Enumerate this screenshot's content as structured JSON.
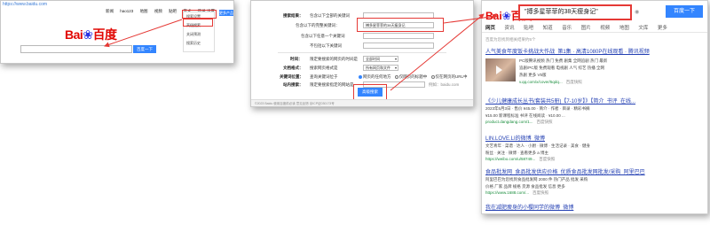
{
  "panel1": {
    "url": "https://www.baidu.com",
    "nav": [
      "新闻",
      "hao123",
      "地图",
      "视频",
      "贴吧",
      "学术",
      "登录"
    ],
    "settings_label": "设置",
    "more_label": "更多产品",
    "settings_menu": [
      "搜索设置",
      "高级搜索",
      "关闭预测",
      "搜索历史"
    ],
    "logo_bai": "Bai",
    "logo_du": "百度",
    "search_placeholder": "",
    "search_button": "百度一下"
  },
  "panel2": {
    "section_search_results": "搜索结果：",
    "fields": [
      {
        "label": "包含以下全部的关键词",
        "value": ""
      },
      {
        "label": "包含以下的完整关键词：",
        "value": "搏多星菲菲的38天瘦身记"
      },
      {
        "label": "包含以下任意一个关键词",
        "value": ""
      },
      {
        "label": "不包括以下关键词",
        "value": ""
      }
    ],
    "time_label": "时间：",
    "time_desc": "限定要搜索的网页的时间是",
    "time_value": "全部时间",
    "doctype_label": "文档格式：",
    "doctype_desc": "搜索网页格式是",
    "doctype_value": "所有网页和文件",
    "position_label": "关键词位置：",
    "position_desc": "查询关键词位于",
    "position_options": [
      "网页的任何地方",
      "仅网页的标题中",
      "仅在网页的URL中"
    ],
    "site_label": "站内搜索：",
    "site_desc": "限定要搜索指定的网站是",
    "site_example": "例如：baidu.com",
    "submit": "高级搜索",
    "footer": "©2023 Baidu 使用百度前必读 意见反馈 京ICP证030173号"
  },
  "panel3": {
    "logo_bai": "Bai",
    "logo_du": "百度",
    "query": "\"搏多星菲菲的38天瘦身记\"",
    "search_button": "百度一下",
    "tabs": [
      "网页",
      "资讯",
      "贴吧",
      "知道",
      "音乐",
      "图片",
      "视频",
      "地图",
      "文库",
      "更多"
    ],
    "result_count": "百度为您找到相关结果约5个",
    "results": [
      {
        "title": "人气美食年度饭卡挑战大作战_第1集 · 高清1080P在线观看 · 腾讯视频",
        "desc": [
          "PC版腾讯视频 热门 免费 剧集 全网追剧 热门 最新",
          "追剧/PC版 免费观看 电视剧 人气 综艺 热播 全网",
          "热剧 更多 V5版"
        ],
        "url": "v.qq.com/x/cover/5qdq...",
        "snap": "百度快照"
      },
      {
        "title": "《少儿健康成长丛书(套装共5册)【7-10岁】》【简介_书评_在线...",
        "desc": [
          "2023年5月3日 · 售价 ¥45.00 · 简介 · 作者 · 目录 · 精彩书摘",
          "¥15.00 新课程标准 书评 在线阅读 · ¥10.00 ..."
        ],
        "url": "product.dangdang.com/1...",
        "snap": "百度快照"
      },
      {
        "title": "LIN.LOVE.LI的微博_微博",
        "desc": [
          "文艺青年 · 菜谱 · 达人 · 小厨 · 微博 · 生活记录 · 美食 · 健身",
          "粉丝 · 关注 · 微博 · 查看更多 a 博主"
        ],
        "url": "https://weibo.com/u/58749...",
        "snap": "百度快照"
      },
      {
        "title": "食品批发网_食品批发供应价格_优质食品批发网批发/采购_阿里巴巴",
        "desc": [
          "阿里巴巴为您找到食品批发网 2000 件 热门产品 批发 采购",
          "价格 厂家 品牌 规格 货源 食品批发 信息 更多"
        ],
        "url": "https://www.1688.com/...",
        "snap": "百度快照"
      },
      {
        "title": "我在减肥瘦身的小樱同学的微博_微博",
        "desc": [],
        "url": "",
        "snap": ""
      }
    ]
  },
  "colors": {
    "baidu_blue": "#3385ff",
    "baidu_red": "#e10602",
    "highlight_red": "#e53935",
    "link_blue": "#2440b3",
    "url_green": "#1b8e3e"
  }
}
